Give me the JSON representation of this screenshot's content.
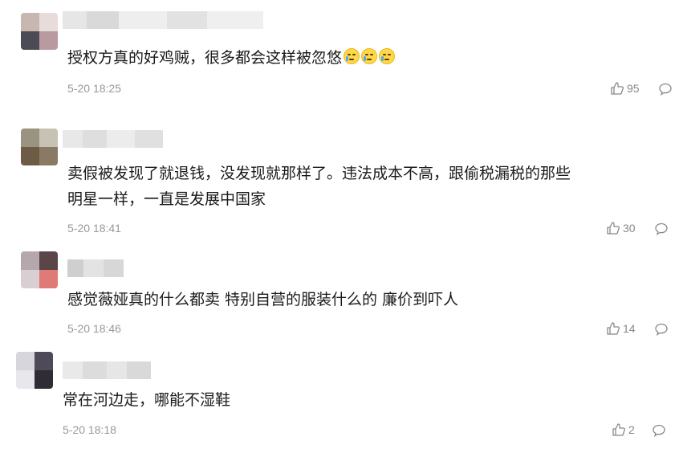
{
  "comments": [
    {
      "text": "授权方真的好鸡贼，很多都会这样被忽悠",
      "emoji_count": 3,
      "emoji_icon": "crying-face-icon",
      "time": "5-20 18:25",
      "likes": "95"
    },
    {
      "text_line1": "卖假被发现了就退钱，没发现就那样了。违法成本不高，跟偷税漏税的那些",
      "text_line2": "明星一样，一直是发展中国家",
      "time": "5-20 18:41",
      "likes": "30"
    },
    {
      "text": "感觉薇娅真的什么都卖 特别自营的服装什么的 廉价到吓人",
      "time": "5-20 18:46",
      "likes": "14"
    },
    {
      "text": "常在河边走，哪能不湿鞋",
      "time": "5-20 18:18",
      "likes": "2"
    }
  ],
  "icons": {
    "like": "thumbs-up-icon",
    "reply": "comment-bubble-icon"
  },
  "colors": {
    "text": "#1a1a1a",
    "meta": "#999999",
    "icon": "#888888"
  }
}
